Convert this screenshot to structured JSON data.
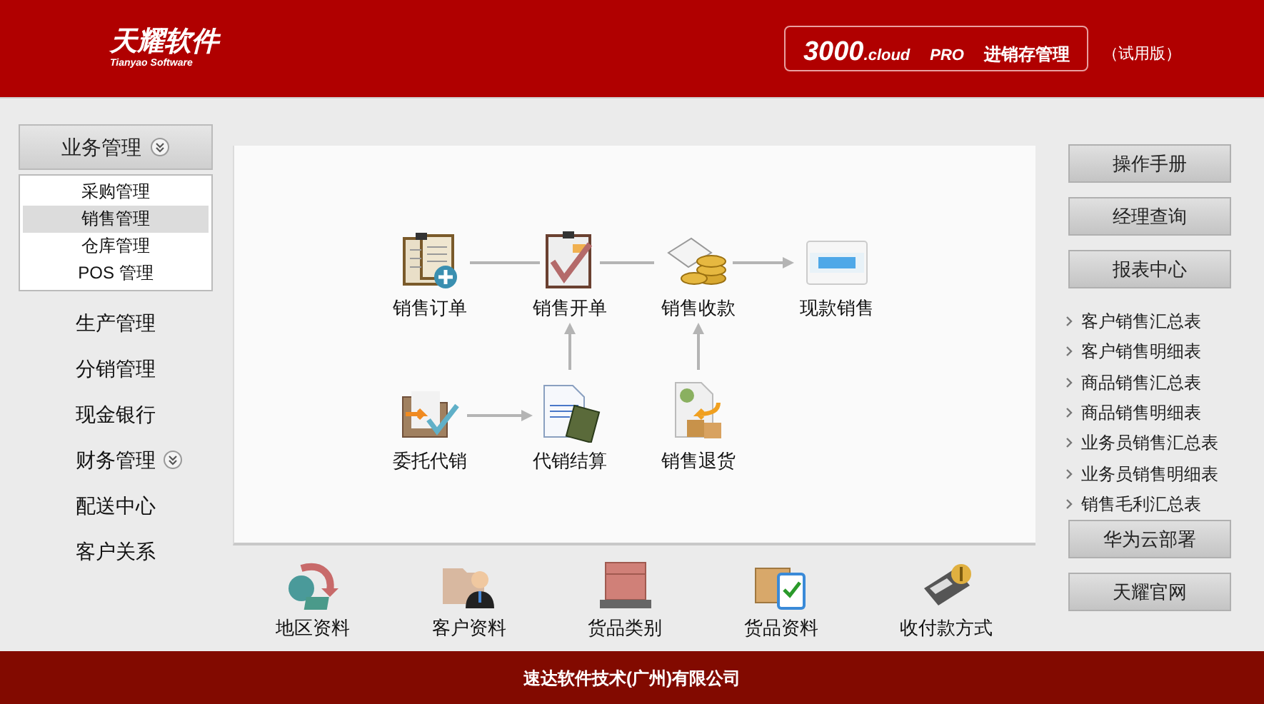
{
  "header": {
    "brand": "天耀软件",
    "brand_sub": "Tianyao Software",
    "product_number": "3000",
    "product_suffix": ".cloud",
    "edition": "PRO",
    "product_name": "进销存管理",
    "trial": "（试用版）"
  },
  "sidebar": {
    "items": [
      {
        "label": "业务管理",
        "kind": "group",
        "collapsible": true,
        "children": [
          {
            "label": "采购管理",
            "selected": false
          },
          {
            "label": "销售管理",
            "selected": true
          },
          {
            "label": "仓库管理",
            "selected": false
          },
          {
            "label": "POS 管理",
            "selected": false
          }
        ]
      },
      {
        "label": "生产管理",
        "kind": "link",
        "collapsible": false
      },
      {
        "label": "分销管理",
        "kind": "link",
        "collapsible": false
      },
      {
        "label": "现金银行",
        "kind": "link",
        "collapsible": false
      },
      {
        "label": "财务管理",
        "kind": "link",
        "collapsible": true
      },
      {
        "label": "配送中心",
        "kind": "link",
        "collapsible": false
      },
      {
        "label": "客户关系",
        "kind": "link",
        "collapsible": false
      }
    ]
  },
  "flow": {
    "nodes": [
      {
        "label": "销售订单"
      },
      {
        "label": "销售开单"
      },
      {
        "label": "销售收款"
      },
      {
        "label": "现款销售"
      },
      {
        "label": "委托代销"
      },
      {
        "label": "代销结算"
      },
      {
        "label": "销售退货"
      }
    ]
  },
  "shortcuts": [
    {
      "label": "地区资料"
    },
    {
      "label": "客户资料"
    },
    {
      "label": "货品类别"
    },
    {
      "label": "货品资料"
    },
    {
      "label": "收付款方式"
    }
  ],
  "right_panel": {
    "top_buttons": [
      "操作手册",
      "经理查询",
      "报表中心"
    ],
    "reports": [
      "客户销售汇总表",
      "客户销售明细表",
      "商品销售汇总表",
      "商品销售明细表",
      "业务员销售汇总表",
      "业务员销售明细表",
      "销售毛利汇总表"
    ],
    "bottom_buttons": [
      "华为云部署",
      "天耀官网"
    ]
  },
  "footer": {
    "company": "速达软件技术(广州)有限公司"
  }
}
